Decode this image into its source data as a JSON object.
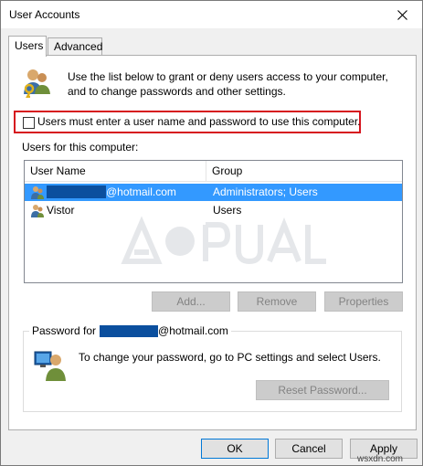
{
  "window": {
    "title": "User Accounts"
  },
  "tabs": [
    {
      "label": "Users",
      "active": true
    },
    {
      "label": "Advanced",
      "active": false
    }
  ],
  "intro_text": "Use the list below to grant or deny users access to your computer, and to change passwords and other settings.",
  "checkbox": {
    "label": "Users must enter a user name and password to use this computer.",
    "checked": false
  },
  "users_label": "Users for this computer:",
  "table": {
    "columns": [
      "User Name",
      "Group"
    ],
    "rows": [
      {
        "name": "@hotmail.com",
        "group": "Administrators; Users",
        "selected": true
      },
      {
        "name": "Vistor",
        "group": "Users",
        "selected": false
      }
    ]
  },
  "buttons": {
    "add": "Add...",
    "remove": "Remove",
    "properties": "Properties"
  },
  "password": {
    "legend_prefix": "Password for",
    "legend_suffix": "@hotmail.com",
    "text": "To change your password, go to PC settings and select Users.",
    "reset_button": "Reset Password..."
  },
  "footer": {
    "ok": "OK",
    "cancel": "Cancel",
    "apply": "Apply"
  },
  "watermark": "wsxdn.com",
  "colors": {
    "selection": "#3399ff",
    "highlight_border": "#d6141e",
    "redaction": "#0b4f9e"
  }
}
